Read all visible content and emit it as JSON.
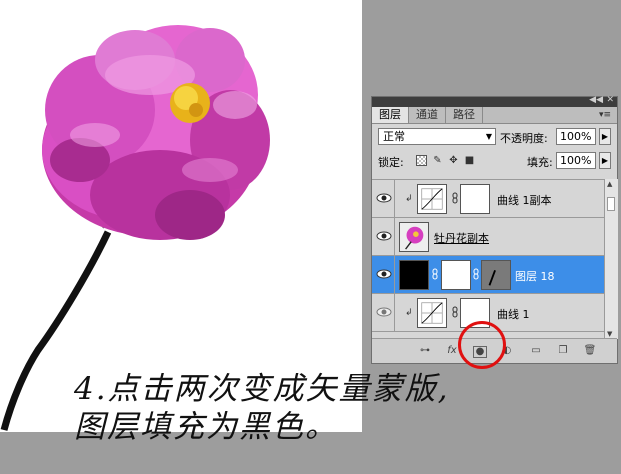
{
  "panel": {
    "tabs": [
      "图层",
      "通道",
      "路径"
    ],
    "blend_mode": "正常",
    "opacity_label": "不透明度:",
    "opacity_value": "100%",
    "lock_label": "锁定:",
    "fill_label": "填充:",
    "fill_value": "100%",
    "layers": [
      {
        "name": "曲线 1副本",
        "type": "curves-adjustment",
        "clipped": true,
        "selected": false
      },
      {
        "name": "牡丹花副本",
        "type": "image",
        "clipped": false,
        "selected": false
      },
      {
        "name": "图层 18",
        "type": "layer-with-vector-mask",
        "clipped": false,
        "selected": true
      },
      {
        "name": "曲线 1",
        "type": "curves-adjustment",
        "clipped": true,
        "selected": false
      }
    ],
    "bottom_icons": [
      "link-icon",
      "fx-icon",
      "add-mask-icon",
      "adjustment-icon",
      "group-icon",
      "new-layer-icon",
      "trash-icon"
    ]
  },
  "caption": {
    "line1": "4.点击两次变成矢量蒙版,",
    "line2": "图层填充为黑色。"
  },
  "colors": {
    "selection": "#3d8ee8",
    "highlight": "#e01010",
    "flower": "#d63fbf"
  }
}
